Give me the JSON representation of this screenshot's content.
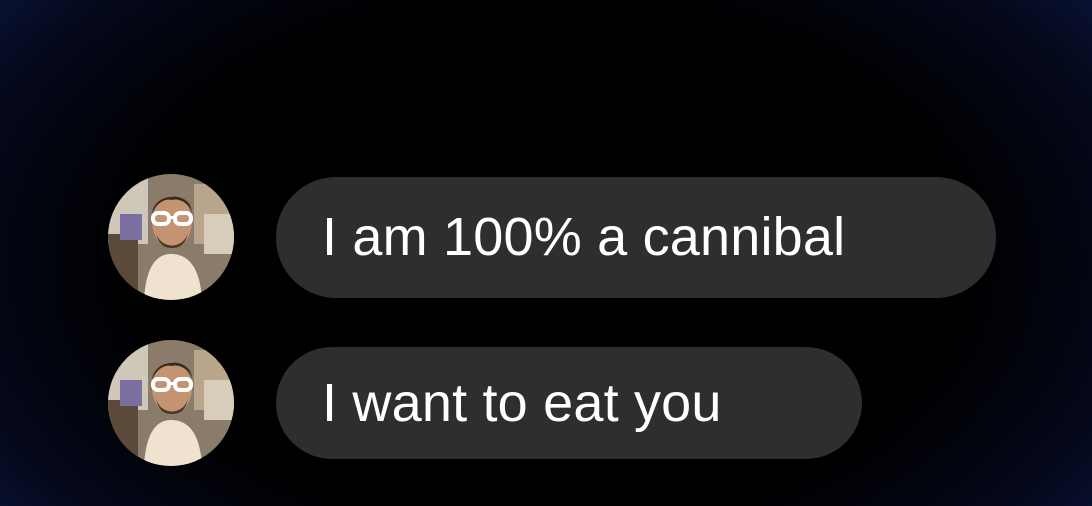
{
  "colors": {
    "background": "#000000",
    "bubble": "#2e2e2e",
    "text": "#ffffff"
  },
  "messages": [
    {
      "text": "I am 100% a cannibal",
      "avatar_icon": "profile-photo-icon"
    },
    {
      "text": "I want to eat you",
      "avatar_icon": "profile-photo-icon"
    }
  ]
}
